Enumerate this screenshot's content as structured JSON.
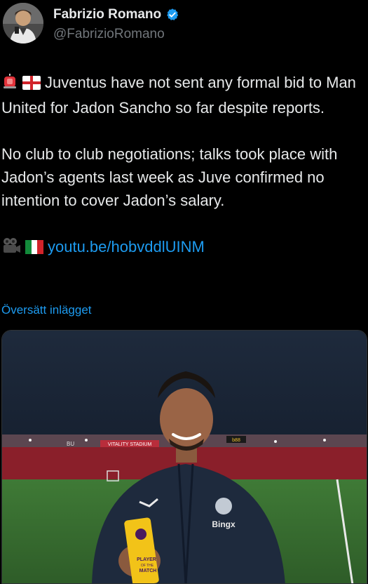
{
  "author": {
    "display_name": "Fabrizio Romano",
    "handle": "@FabrizioRomano",
    "verified": true
  },
  "tweet": {
    "line1_text": "Juventus have not sent any formal bid to Man United for Jadon Sancho so far despite reports.",
    "line2_text": "No club to club negotiations; talks took place with Jadon’s agents last week as Juve confirmed no intention to cover Jadon’s salary.",
    "link_text": "youtu.be/hobvddlUINM",
    "icons": [
      "siren-emoji",
      "england-flag-emoji",
      "camera-emoji",
      "italy-flag-emoji"
    ]
  },
  "translate_label": "Översätt inlägget",
  "media": {
    "stadium_banners": [
      "VITALITY STADIUM",
      "b88",
      "BU"
    ],
    "shirt_sponsor": "Bingx",
    "trophy_text": [
      "PLAYER",
      "OF THE",
      "MATCH"
    ]
  },
  "colors": {
    "background": "#000000",
    "text": "#e7e9ea",
    "secondary": "#71767b",
    "link": "#1d9bf0"
  }
}
